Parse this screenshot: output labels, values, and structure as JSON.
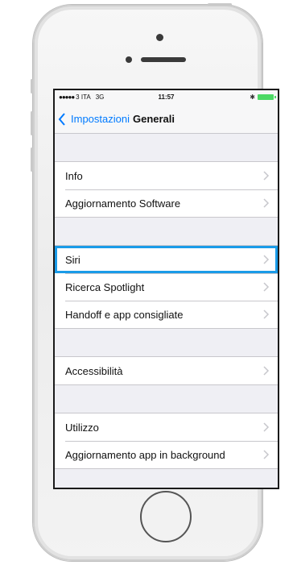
{
  "status_bar": {
    "carrier": "3 ITA",
    "network": "3G",
    "time": "11:57",
    "battery_color": "#4cd964"
  },
  "nav": {
    "back_label": "Impostazioni",
    "title": "Generali",
    "accent_color": "#007aff"
  },
  "groups": [
    {
      "items": [
        {
          "label": "Info"
        },
        {
          "label": "Aggiornamento Software"
        }
      ]
    },
    {
      "items": [
        {
          "label": "Siri",
          "highlighted": true
        },
        {
          "label": "Ricerca Spotlight"
        },
        {
          "label": "Handoff e app consigliate"
        }
      ]
    },
    {
      "items": [
        {
          "label": "Accessibilità"
        }
      ]
    },
    {
      "items": [
        {
          "label": "Utilizzo"
        },
        {
          "label": "Aggiornamento app in background"
        }
      ]
    }
  ],
  "highlight_color": "#1a9be8",
  "icons": [
    "back-chevron-icon",
    "chevron-right-icon",
    "bluetooth-icon",
    "battery-icon",
    "signal-dots-icon"
  ]
}
